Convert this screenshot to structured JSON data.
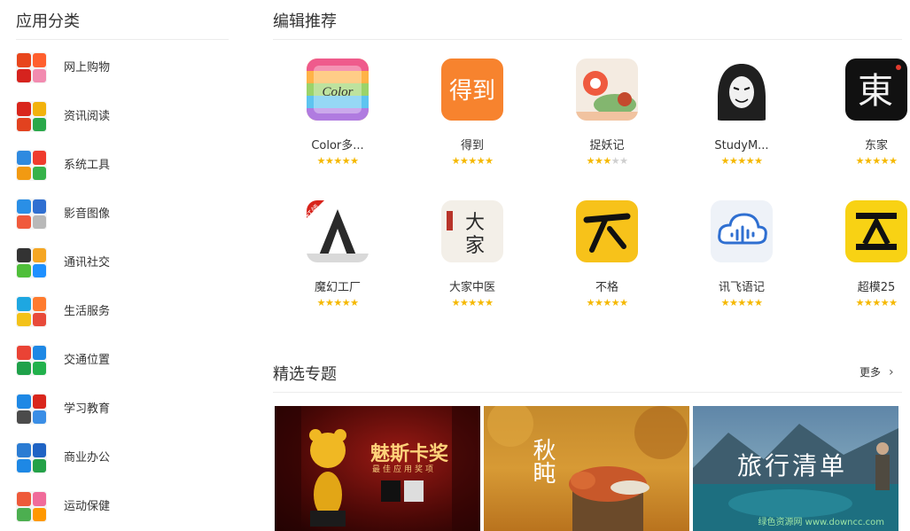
{
  "sidebar": {
    "title": "应用分类",
    "items": [
      {
        "label": "网上购物",
        "icon": "shopping-icon",
        "colors": [
          "#e8461c",
          "#ff5f2e",
          "#d6231e",
          "#f28bb0"
        ]
      },
      {
        "label": "资讯阅读",
        "icon": "news-icon",
        "colors": [
          "#d9261c",
          "#f2b20c",
          "#e2421f",
          "#2aa84a"
        ]
      },
      {
        "label": "系统工具",
        "icon": "tools-icon",
        "colors": [
          "#2f8ae0",
          "#ef3b2d",
          "#f29a12",
          "#36b24a"
        ]
      },
      {
        "label": "影音图像",
        "icon": "media-icon",
        "colors": [
          "#2a8fe6",
          "#2f6fd1",
          "#f05a3c",
          "#b8b8b8"
        ]
      },
      {
        "label": "通讯社交",
        "icon": "social-icon",
        "colors": [
          "#333333",
          "#f5a623",
          "#4fbf3a",
          "#1e90ff"
        ]
      },
      {
        "label": "生活服务",
        "icon": "life-icon",
        "colors": [
          "#1ea7e1",
          "#ff7b2e",
          "#f3c21a",
          "#e84a3a"
        ]
      },
      {
        "label": "交通位置",
        "icon": "map-icon",
        "colors": [
          "#ea4335",
          "#1e88e5",
          "#1fa14a",
          "#22b14c"
        ]
      },
      {
        "label": "学习教育",
        "icon": "education-icon",
        "colors": [
          "#1e88e5",
          "#d9261c",
          "#4b4b4b",
          "#3a8ee6"
        ]
      },
      {
        "label": "商业办公",
        "icon": "office-icon",
        "colors": [
          "#2b7cd3",
          "#1f63c4",
          "#1e88e5",
          "#24a148"
        ]
      },
      {
        "label": "运动保健",
        "icon": "health-icon",
        "colors": [
          "#ee5a3a",
          "#f06b9a",
          "#4caf50",
          "#ff9800"
        ]
      }
    ]
  },
  "editor": {
    "title": "编辑推荐",
    "apps": [
      {
        "name": "Color多...",
        "rating": 4.5,
        "icon": "color-app-icon"
      },
      {
        "name": "得到",
        "rating": 4.5,
        "icon": "dedao-icon"
      },
      {
        "name": "捉妖记",
        "rating": 2.5,
        "icon": "monster-hunt-icon"
      },
      {
        "name": "StudyM...",
        "rating": 4.5,
        "icon": "mask-icon"
      },
      {
        "name": "东家",
        "rating": 4.5,
        "icon": "dongjia-icon"
      },
      {
        "name": "魔幻工厂",
        "rating": 5,
        "icon": "magic-factory-icon"
      },
      {
        "name": "大家中医",
        "rating": 4.5,
        "icon": "dajia-tcm-icon"
      },
      {
        "name": "不格",
        "rating": 4.5,
        "icon": "buge-icon"
      },
      {
        "name": "讯飞语记",
        "rating": 4.5,
        "icon": "iflytek-note-icon"
      },
      {
        "name": "超模25",
        "rating": 4.5,
        "icon": "supermodel-icon"
      }
    ]
  },
  "topics": {
    "title": "精选专题",
    "more": "更多",
    "items": [
      {
        "text": "魅斯卡奖",
        "sub": "最佳应用奖项"
      },
      {
        "text": "秋盹"
      },
      {
        "text": "旅行清单"
      }
    ]
  },
  "watermark": "绿色资源网 www.downcc.com",
  "colors": {
    "star_on": "#f5b800",
    "star_off": "#cfcfcf",
    "divider": "#ececec"
  }
}
